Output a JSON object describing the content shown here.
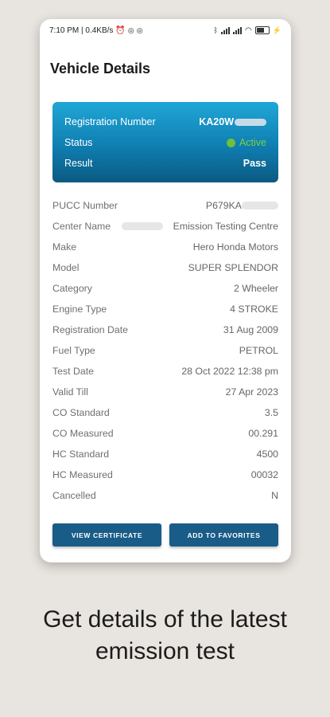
{
  "statusbar": {
    "time_speed": "7:10 PM | 0.4KB/s",
    "alarm_glyph": "⏰",
    "icons": [
      "alarm-icon",
      "notification-icon",
      "bluetooth-icon",
      "signal-icon",
      "wifi-icon",
      "battery-icon",
      "charging-icon"
    ]
  },
  "page": {
    "title": "Vehicle Details"
  },
  "summary": {
    "registration_label": "Registration Number",
    "registration_value": "KA20W",
    "status_label": "Status",
    "status_value": "Active",
    "result_label": "Result",
    "result_value": "Pass",
    "status_color": "#6fbf3a"
  },
  "details": {
    "pucc_label": "PUCC Number",
    "pucc_value": "P679KA",
    "center_label": "Center Name",
    "center_value": "Emission Testing Centre",
    "make_label": "Make",
    "make_value": "Hero Honda Motors",
    "model_label": "Model",
    "model_value": "SUPER SPLENDOR",
    "category_label": "Category",
    "category_value": "2 Wheeler",
    "engine_label": "Engine Type",
    "engine_value": "4 STROKE",
    "regdate_label": "Registration Date",
    "regdate_value": "31 Aug 2009",
    "fuel_label": "Fuel Type",
    "fuel_value": "PETROL",
    "testdate_label": "Test Date",
    "testdate_value": "28 Oct 2022 12:38 pm",
    "valid_label": "Valid Till",
    "valid_value": "27 Apr 2023",
    "co_std_label": "CO Standard",
    "co_std_value": "3.5",
    "co_meas_label": "CO Measured",
    "co_meas_value": "00.291",
    "hc_std_label": "HC Standard",
    "hc_std_value": "4500",
    "hc_meas_label": "HC Measured",
    "hc_meas_value": "00032",
    "cancelled_label": "Cancelled",
    "cancelled_value": "N"
  },
  "actions": {
    "view_certificate": "VIEW CERTIFICATE",
    "add_favorites": "ADD TO FAVORITES",
    "button_color": "#195c88"
  },
  "caption": {
    "line1": "Get details of the latest",
    "line2": "emission test"
  }
}
